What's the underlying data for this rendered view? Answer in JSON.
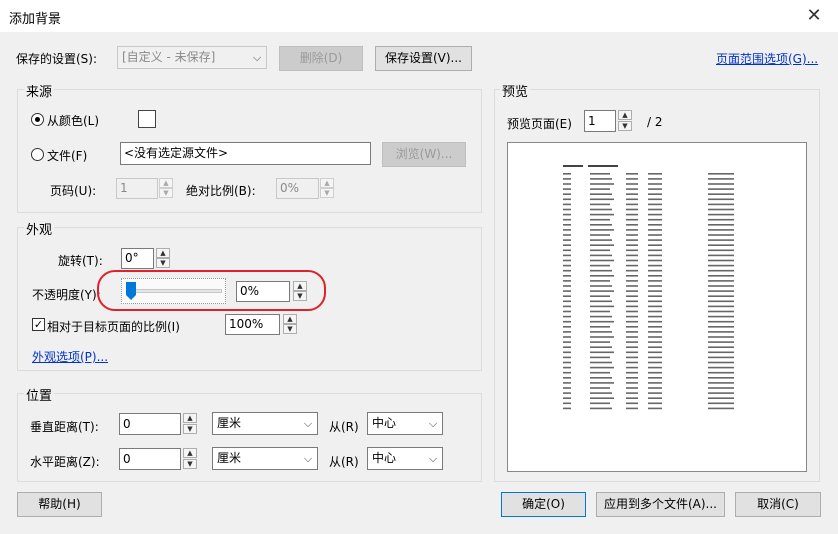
{
  "window": {
    "title": "添加背景",
    "close_glyph": "✕"
  },
  "saved_settings": {
    "label": "保存的设置(S):",
    "value": "[自定义 - 未保存]",
    "delete_btn": "删除(D)",
    "save_btn": "保存设置(V)...",
    "page_range_link": "页面范围选项(G)..."
  },
  "source": {
    "group": "来源",
    "from_color": "从颜色(L)",
    "from_file": "文件(F)",
    "file_placeholder": "<没有选定源文件>",
    "browse_btn": "浏览(W)...",
    "page_no_label": "页码(U):",
    "page_no_value": "1",
    "abs_scale_label": "绝对比例(B):",
    "abs_scale_value": "0%",
    "selected": "color",
    "color": "#ffffff"
  },
  "appearance": {
    "group": "外观",
    "rotation_label": "旋转(T):",
    "rotation_value": "0°",
    "opacity_label": "不透明度(Y):",
    "opacity_value": "0%",
    "opacity_fraction": 0,
    "relative_scale_label": "相对于目标页面的比例(I)",
    "relative_scale_checked": true,
    "relative_scale_value": "100%",
    "options_link": "外观选项(P)...",
    "annotation_color": "#e0202a"
  },
  "position": {
    "group": "位置",
    "vertical_label": "垂直距离(T):",
    "vertical_value": "0",
    "vertical_unit": "厘米",
    "vertical_from_label": "从(R)",
    "vertical_from": "中心",
    "horizontal_label": "水平距离(Z):",
    "horizontal_value": "0",
    "horizontal_unit": "厘米",
    "horizontal_from_label": "从(R)",
    "horizontal_from": "中心"
  },
  "preview": {
    "group": "预览",
    "page_label": "预览页面(E)",
    "page_value": "1",
    "page_total": "/ 2"
  },
  "buttons": {
    "help": "帮助(H)",
    "ok": "确定(O)",
    "apply_multiple": "应用到多个文件(A)...",
    "cancel": "取消(C)"
  }
}
